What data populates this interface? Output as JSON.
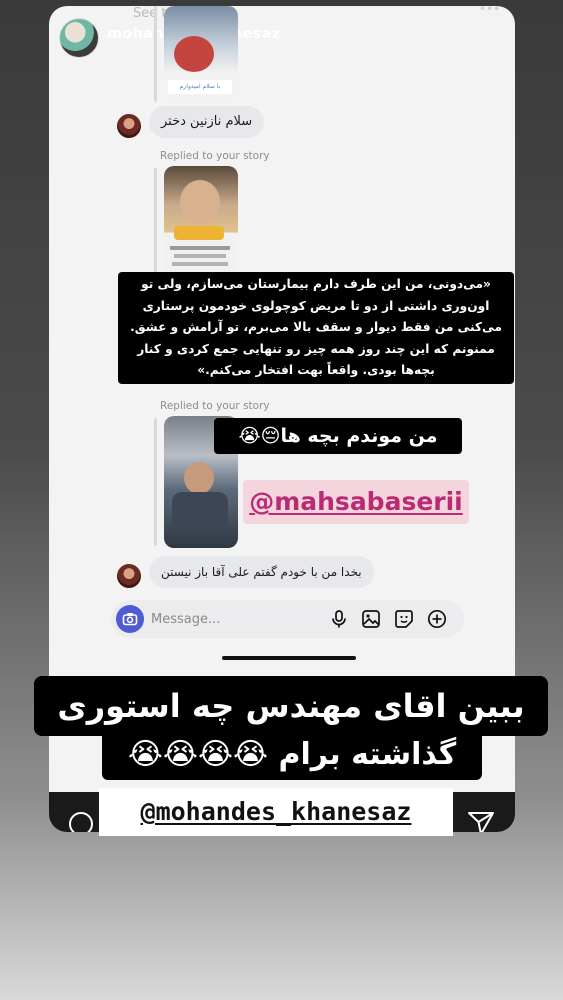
{
  "story": {
    "username": "mohandes_khanesaz",
    "top_hint": "See translation"
  },
  "chat": {
    "messages": [
      {
        "text": "سلام نازنین دختر"
      },
      {
        "text": "بخدا من با خودم گفتم علی آقا باز نیستن"
      }
    ],
    "replied_label_1": "Replied to your story",
    "replied_label_2": "Replied to your story",
    "composer_placeholder": "Message...",
    "first_thumb_caption": "با سلام امیدوارم"
  },
  "overlays": {
    "quote_lines": [
      "«می‌دونی، من این طرف دارم بیمارستان می‌سازم، ولی تو",
      "اون‌وری داشتی از دو تا مریض کوچولوی خودمون پرستاری",
      "می‌کنی من فقط دیوار و سقف بالا می‌برم، تو آرامش و عشق.",
      "ممنونم که این چند روز همه چیز رو تنهایی جمع کردی و کنار",
      "بچه‌ها بودی. واقعاً بهت افتخار می‌کنم.»"
    ],
    "sticker_text": "من موندم بچه ها😔😭",
    "mention_mahsa": "@mahsabaserii",
    "bottom_caption_line1": "ببین اقای مهندس چه استوری",
    "bottom_caption_line2": "گذاشته برام 😭😭😭😭",
    "mention_bottom": "@mohandes_khanesaz"
  },
  "icons": [
    "camera-icon",
    "microphone-icon",
    "gallery-icon",
    "sticker-icon",
    "add-icon",
    "send-icon",
    "circle-icon",
    "more-icon"
  ],
  "colors": {
    "accent": "#4f5bd5",
    "mention_pink": "#b92b73"
  }
}
